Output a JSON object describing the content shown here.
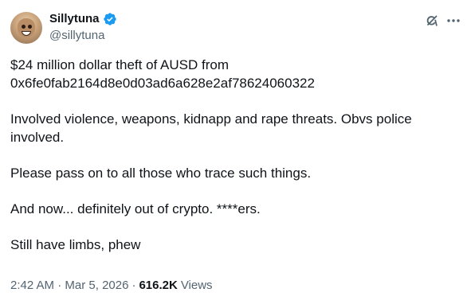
{
  "author": {
    "display_name": "Sillytuna",
    "handle": "@sillytuna",
    "verified": true
  },
  "tweet": {
    "paragraphs": [
      "$24 million dollar theft of AUSD from\n0x6fe0fab2164d8e0d03ad6a628e2af78624060322",
      "Involved violence, weapons, kidnapp and rape threats. Obvs police\ninvolved.",
      "Please pass on to all those who trace such things.",
      "And now... definitely out of crypto. ****ers.",
      "Still have limbs, phew"
    ],
    "time": "2:42 AM",
    "separator": "·",
    "date": "Mar 5, 2026",
    "views_count": "616.2K",
    "views_label": "Views"
  },
  "icons": {
    "verified": "verified-badge-icon",
    "grok": "grok-icon",
    "more": "more-options-icon"
  },
  "colors": {
    "text_primary": "#0f1419",
    "text_secondary": "#536471",
    "verified_blue": "#1d9bf0",
    "background": "#ffffff"
  }
}
